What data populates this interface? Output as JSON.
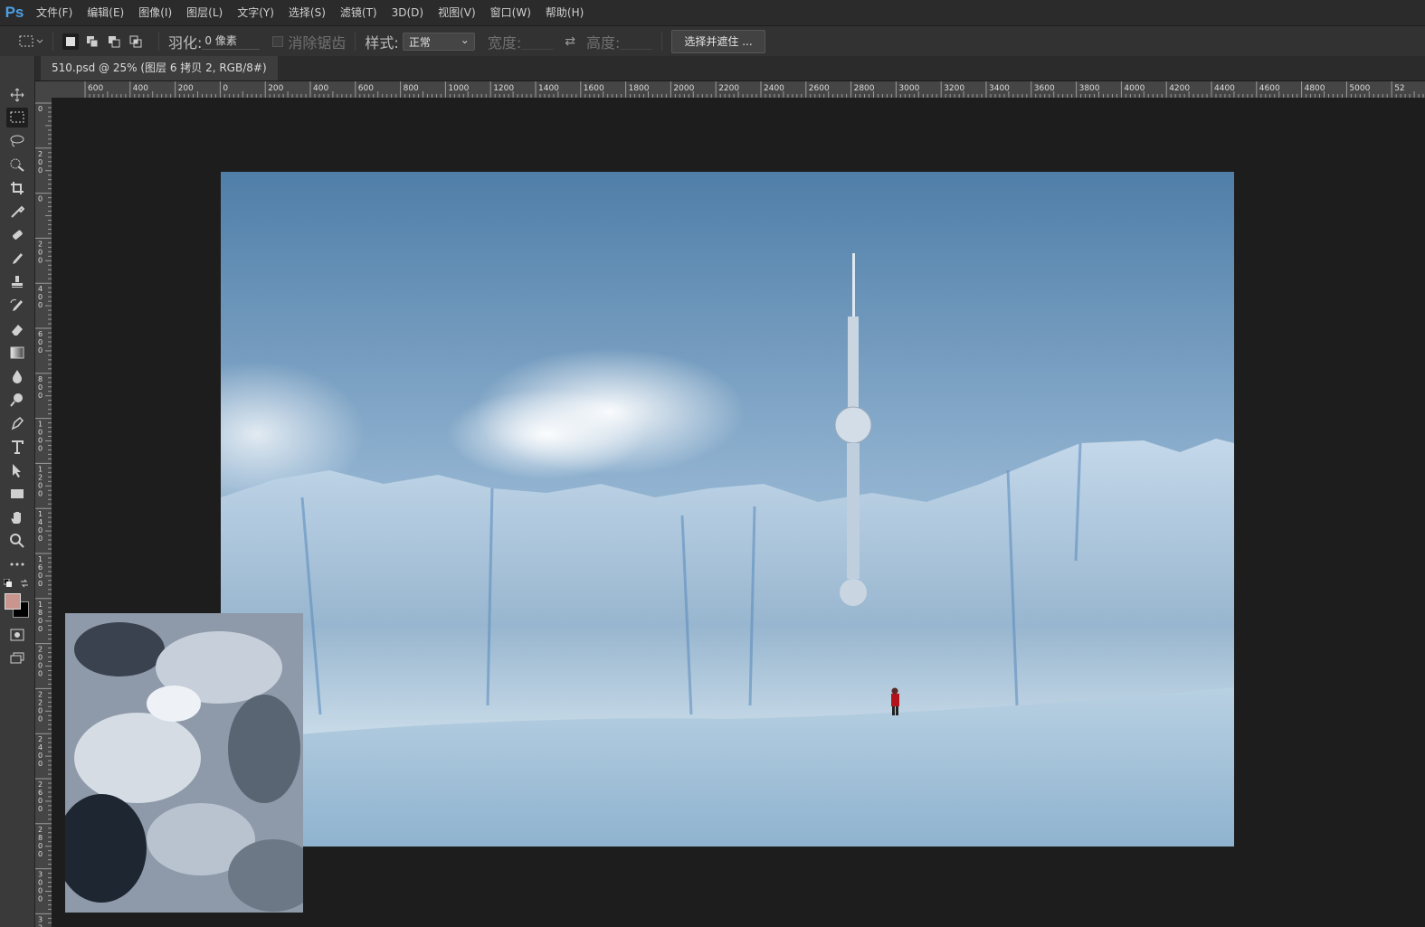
{
  "app": {
    "logo": "Ps"
  },
  "menubar": {
    "items": [
      "文件(F)",
      "编辑(E)",
      "图像(I)",
      "图层(L)",
      "文字(Y)",
      "选择(S)",
      "滤镜(T)",
      "3D(D)",
      "视图(V)",
      "窗口(W)",
      "帮助(H)"
    ]
  },
  "options": {
    "feather_label": "羽化:",
    "feather_value": "0 像素",
    "antialias_label": "消除锯齿",
    "style_label": "样式:",
    "style_value": "正常",
    "width_label": "宽度:",
    "height_label": "高度:",
    "select_mask_button": "选择并遮住 ..."
  },
  "document": {
    "tab_title": "510.psd @ 25% (图层 6 拷贝 2, RGB/8#)"
  },
  "rulers": {
    "horizontal": [
      "600",
      "400",
      "200",
      "0",
      "200",
      "400",
      "600",
      "800",
      "1000",
      "1200",
      "1400",
      "1600",
      "1800",
      "2000",
      "2200",
      "2400",
      "2600",
      "2800",
      "3000",
      "3200",
      "3400",
      "3600",
      "3800",
      "4000",
      "4200",
      "4400",
      "4600",
      "4800",
      "5000",
      "52"
    ],
    "vertical": [
      "0",
      "200",
      "0",
      "200",
      "400",
      "600",
      "800",
      "1000",
      "1200",
      "1400",
      "1600",
      "1800",
      "2000",
      "2200",
      "2400",
      "2600",
      "2800",
      "3000",
      "32"
    ]
  },
  "colors": {
    "foreground": "#c9958f",
    "background": "#000000",
    "accent": "#4a9fe6"
  },
  "tools": [
    "move-icon",
    "marquee-icon",
    "lasso-icon",
    "quick-select-icon",
    "crop-icon",
    "eyedropper-icon",
    "healing-icon",
    "brush-icon",
    "stamp-icon",
    "history-brush-icon",
    "eraser-icon",
    "gradient-icon",
    "blur-icon",
    "dodge-icon",
    "pen-icon",
    "type-icon",
    "path-select-icon",
    "rectangle-icon",
    "hand-icon",
    "zoom-icon",
    "more-icon"
  ]
}
